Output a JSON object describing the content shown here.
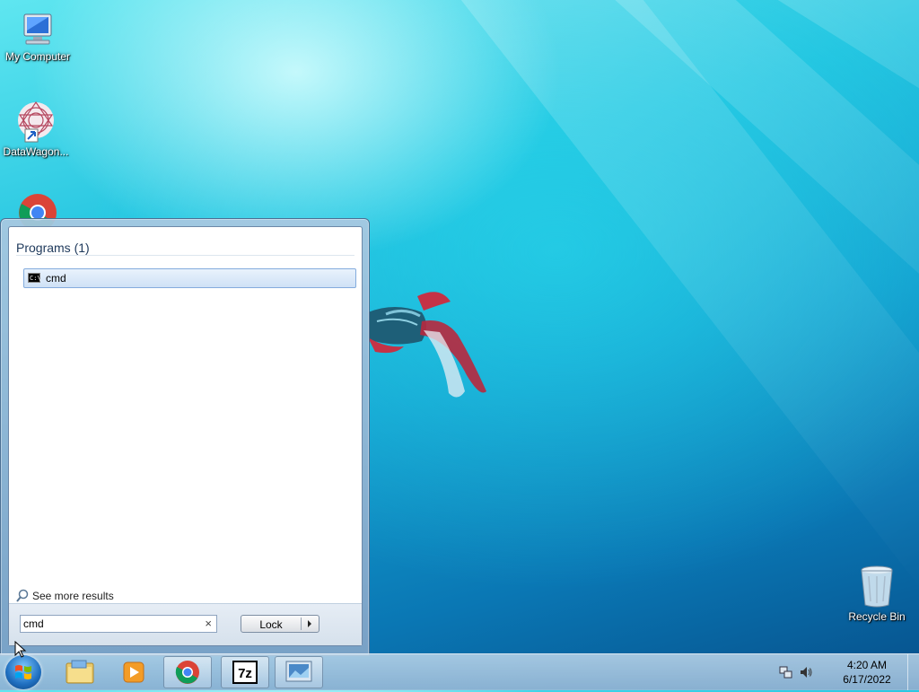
{
  "desktop": {
    "icons": [
      {
        "label": "My Computer"
      },
      {
        "label": "DataWagon..."
      },
      {
        "label": "Google Chrome"
      },
      {
        "label": "Recycle Bin"
      }
    ]
  },
  "start_menu": {
    "section_title": "Programs (1)",
    "results": [
      {
        "label": "cmd",
        "icon": "cmd-icon"
      }
    ],
    "see_more_label": "See more results",
    "search": {
      "value": "cmd",
      "clear_symbol": "×"
    },
    "lock_label": "Lock"
  },
  "taskbar": {
    "buttons": [
      {
        "name": "windows-explorer"
      },
      {
        "name": "windows-media-player"
      },
      {
        "name": "google-chrome"
      },
      {
        "name": "7-zip"
      },
      {
        "name": "remote-desktop"
      }
    ],
    "clock": {
      "time": "4:20 AM",
      "date": "6/17/2022"
    }
  },
  "colors": {
    "desktop_accent": "#139fcf",
    "start_menu_border": "#4b6f93",
    "selected_item_border": "#84acdd"
  }
}
